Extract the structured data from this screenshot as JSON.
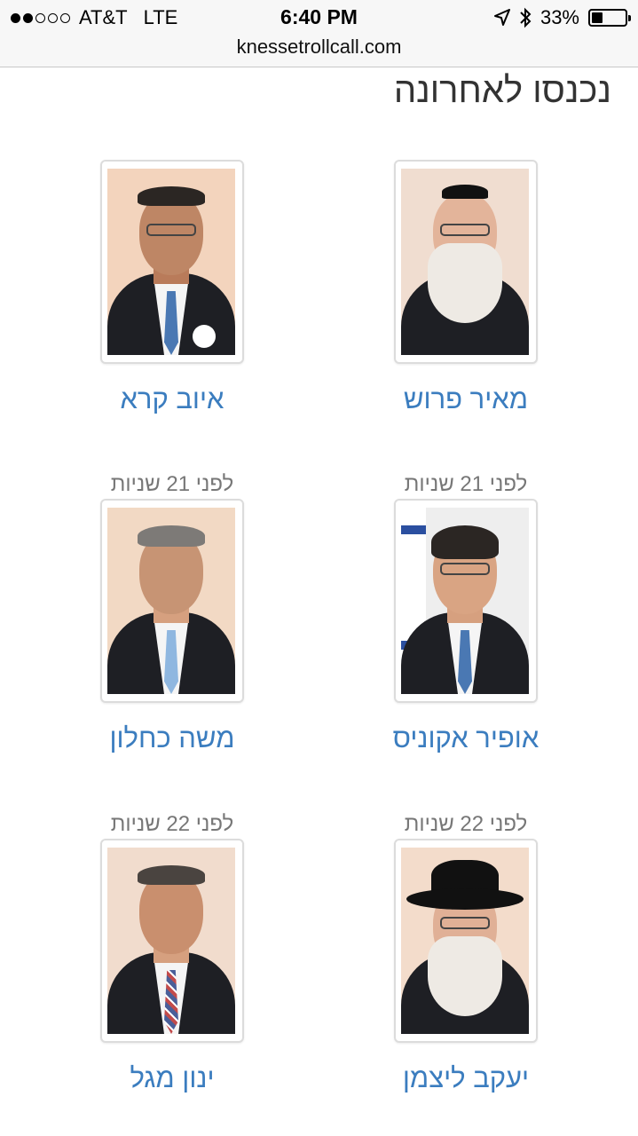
{
  "status_bar": {
    "carrier": "AT&T",
    "network": "LTE",
    "time": "6:40 PM",
    "battery": "33%",
    "battery_level": 0.33,
    "icons": [
      "signal-dots-icon",
      "location-arrow-icon",
      "bluetooth-icon",
      "battery-icon"
    ]
  },
  "url_bar": {
    "url": "knessetrollcall.com"
  },
  "page": {
    "title": "נכנסו לאחרונה"
  },
  "members": [
    {
      "name": "מאיר פרוש",
      "ago": ""
    },
    {
      "name": "איוב קרא",
      "ago": ""
    },
    {
      "name": "אופיר אקוניס",
      "ago": "לפני 21 שניות"
    },
    {
      "name": "משה כחלון",
      "ago": "לפני 21 שניות"
    },
    {
      "name": "יעקב ליצמן",
      "ago": "לפני 22 שניות"
    },
    {
      "name": "ינון מגל",
      "ago": "לפני 22 שניות"
    }
  ],
  "colors": {
    "link": "#3b7dbf",
    "muted": "#777777",
    "background": "#ffffff"
  }
}
